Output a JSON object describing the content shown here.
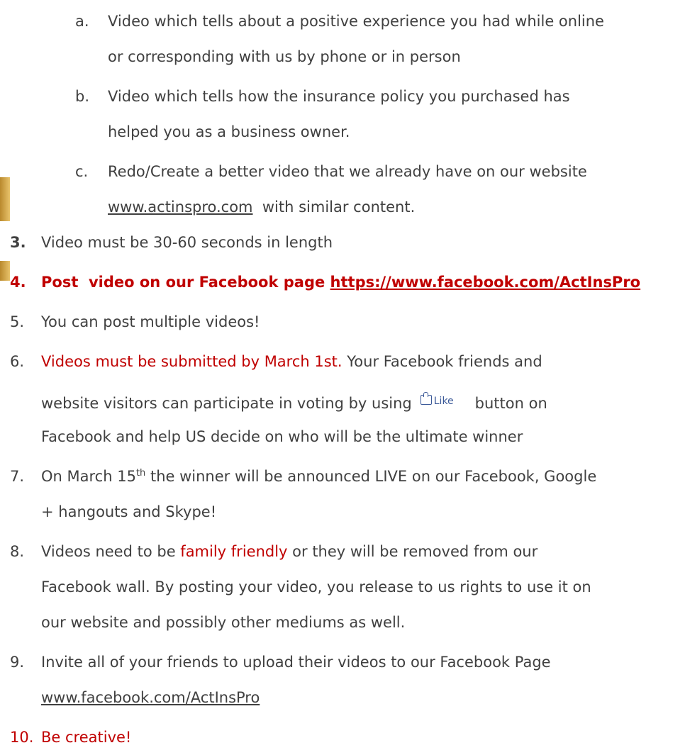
{
  "sub_a": {
    "letter": "a.",
    "line1": "Video which tells about a positive experience you had while online",
    "line2": "or corresponding with us by phone or in person"
  },
  "sub_b": {
    "letter": "b.",
    "line1": "Video which tells how the insurance policy you purchased has",
    "line2": "helped you as a business owner."
  },
  "sub_c": {
    "letter": "c.",
    "line1": "Redo/Create a better video that we already have on our website",
    "link": "www.actinspro.com",
    "rest": "with similar content."
  },
  "item3": {
    "num": "3.",
    "text": "Video must be 30-60 seconds in length"
  },
  "item4": {
    "num": "4.",
    "text": "Post  video on our Facebook page ",
    "link": "https://www.facebook.com/ActInsPro"
  },
  "item5": {
    "num": "5.",
    "text": "You can post multiple videos!"
  },
  "item6": {
    "num": "6.",
    "red_text": "Videos must be submitted by March 1st.",
    "text1": " Your Facebook friends and",
    "line2_pre": "website visitors can participate in voting by using",
    "like_label": "Like",
    "line2_post": "button on",
    "line3": "Facebook and help US decide on who will be the ultimate winner"
  },
  "item7": {
    "num": "7.",
    "pre": "On March 15",
    "sup": "th",
    "post": " the winner will be announced LIVE on our Facebook, Google",
    "line2": "+ hangouts and Skype!"
  },
  "item8": {
    "num": "8.",
    "pre": "Videos need to be ",
    "highlight": "family friendly",
    "post": " or they will be removed from our",
    "line2": "Facebook wall. By posting your video, you release to us rights to use it on",
    "line3": "our website and possibly other mediums as well."
  },
  "item9": {
    "num": "9.",
    "line1": "Invite all of your friends to upload their videos to our Facebook Page",
    "link": "www.facebook.com/ActInsPro"
  },
  "item10": {
    "num": "10.",
    "text": "Be creative!"
  }
}
